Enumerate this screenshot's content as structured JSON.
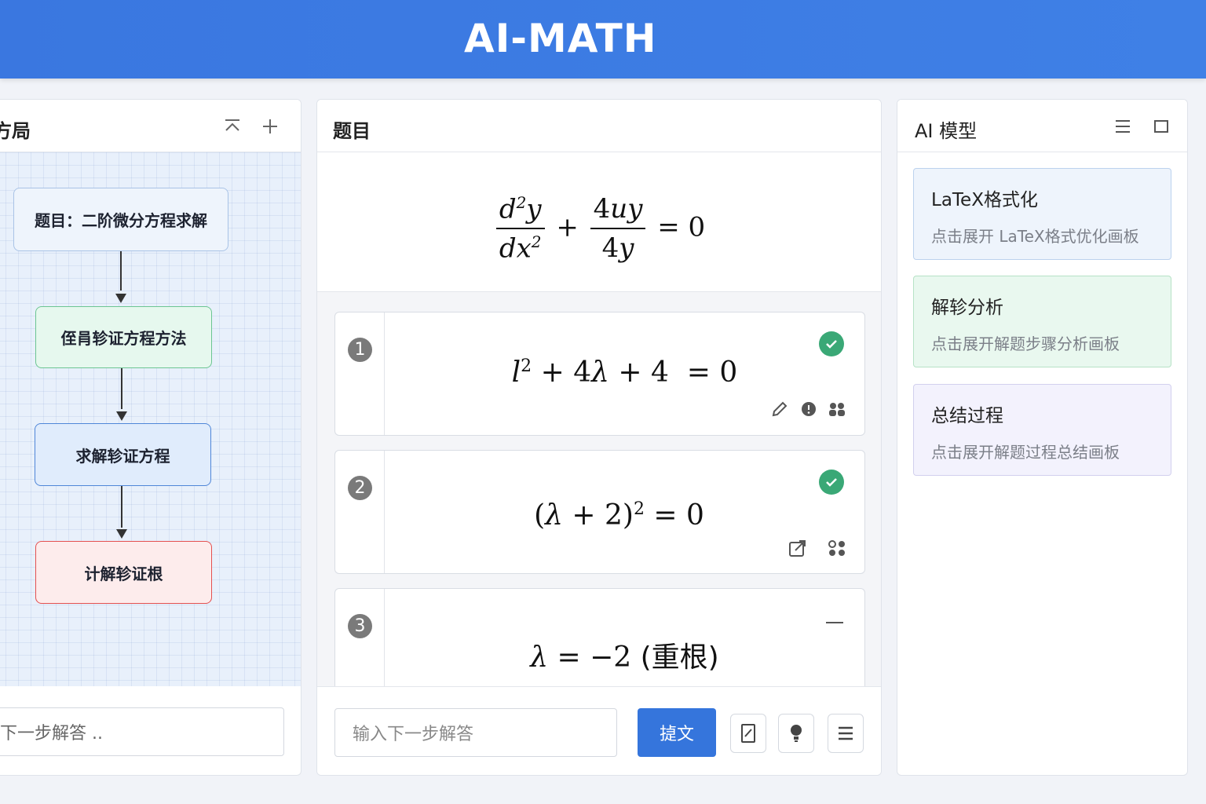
{
  "app": {
    "title": "AI-MATH"
  },
  "left_panel": {
    "title": "方局",
    "flow_nodes": [
      {
        "label": "题目：二阶微分方程求解",
        "bg": "#eef4fc",
        "border": "#a9c3e6"
      },
      {
        "label": "侄肙轸证方程方法",
        "bg": "#e6f8ee",
        "border": "#6cc592"
      },
      {
        "label": "求解轸证方程",
        "bg": "#e0ecfc",
        "border": "#4f86d8"
      },
      {
        "label": "计解轸证根",
        "bg": "#fdecec",
        "border": "#e45050"
      }
    ],
    "input_value": "下一步解答 .."
  },
  "center_panel": {
    "title": "题目",
    "steps": [
      {
        "number": "1",
        "status": "check"
      },
      {
        "number": "2",
        "status": "check"
      },
      {
        "number": "3",
        "status": "dash",
        "suffix": "(重根)"
      }
    ],
    "input_placeholder": "输入下一步解答",
    "submit_label": "㨗文"
  },
  "right_panel": {
    "title": "AI 模型",
    "cards": [
      {
        "title": "LaTeX格式化",
        "subtitle": "点击展开 LaTeX格式优化画板",
        "bg": "#eef4fc",
        "border": "#bcd2ee"
      },
      {
        "title": "解轸分析",
        "subtitle": "点击展开解题步骤分析画板",
        "bg": "#e9f8ef",
        "border": "#b6e2c6"
      },
      {
        "title": "总结过程",
        "subtitle": "点击展开解题过程总结画板",
        "bg": "#f3f2fd",
        "border": "#d2d0ee"
      }
    ]
  },
  "colors": {
    "header": "#3a77e0",
    "accent": "#3575dc",
    "check": "#3aa876"
  }
}
